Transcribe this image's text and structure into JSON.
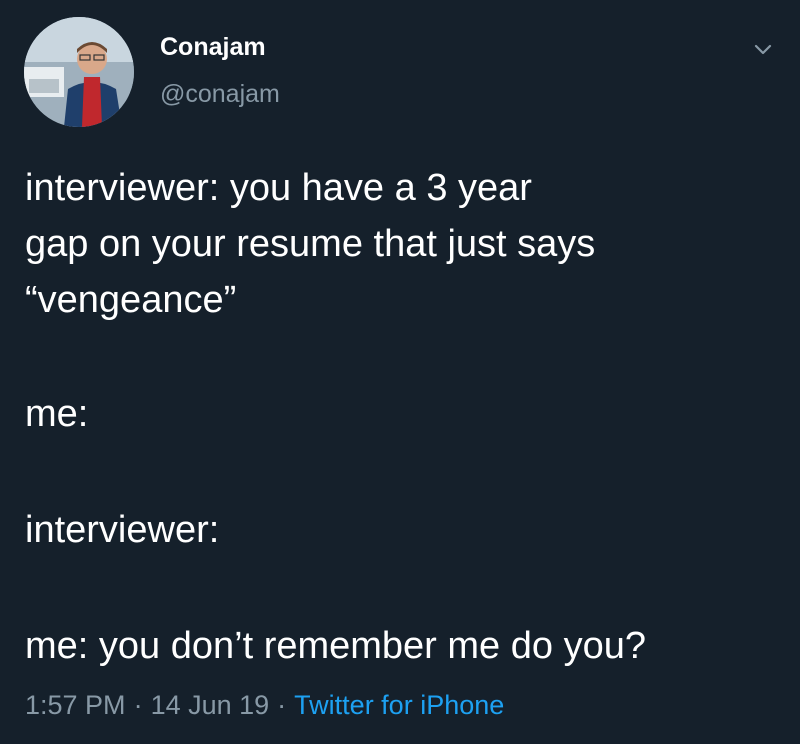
{
  "user": {
    "display_name": "Conajam",
    "handle": "@conajam"
  },
  "icons": {
    "avatar": "profile-photo",
    "menu": "chevron-down-icon"
  },
  "tweet": {
    "lines": [
      "interviewer: you have a 3 year",
      "gap on your resume that just says",
      "“vengeance”",
      "me:",
      "interviewer:",
      "me: you don’t remember me do you?"
    ]
  },
  "meta": {
    "time": "1:57 PM",
    "separator": "·",
    "date": "14 Jun 19",
    "source": "Twitter for iPhone"
  },
  "colors": {
    "background": "#15202b",
    "text": "#ffffff",
    "secondary": "#8899a6",
    "link": "#1da1f2"
  }
}
